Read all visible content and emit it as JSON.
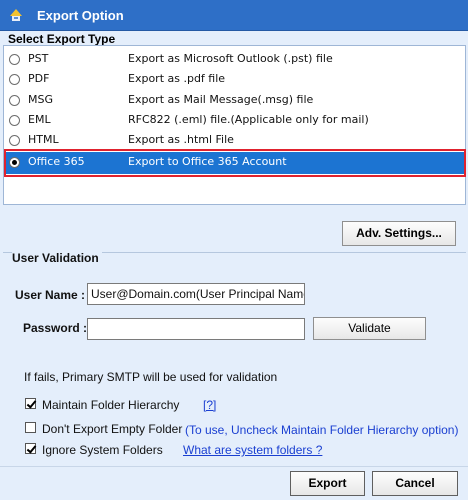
{
  "window": {
    "title": "Export Option"
  },
  "export_type": {
    "section_title": "Select Export Type",
    "options": [
      {
        "name": "PST",
        "description": "Export as Microsoft Outlook (.pst) file",
        "selected": false
      },
      {
        "name": "PDF",
        "description": "Export as .pdf file",
        "selected": false
      },
      {
        "name": "MSG",
        "description": "Export as Mail Message(.msg) file",
        "selected": false
      },
      {
        "name": "EML",
        "description": "RFC822 (.eml) file.(Applicable only for mail)",
        "selected": false
      },
      {
        "name": "HTML",
        "description": "Export as .html File",
        "selected": false
      },
      {
        "name": "Office 365",
        "description": "Export to Office 365 Account",
        "selected": true
      }
    ],
    "selected_color": "#1c74d2",
    "highlight_color": "#e0222e"
  },
  "adv_settings": {
    "label": "Adv. Settings..."
  },
  "user_validation": {
    "title": "User Validation",
    "username_label": "User Name :",
    "username_value": "User@Domain.com(User Principal Name)",
    "password_label": "Password :",
    "password_value": "",
    "validate_label": "Validate",
    "note": "If fails, Primary SMTP will be used for validation"
  },
  "options": {
    "maintain_hierarchy": {
      "label": "Maintain Folder Hierarchy",
      "checked": true,
      "help_link": "[?]"
    },
    "dont_export_empty": {
      "label": "Don't Export Empty Folder",
      "checked": false,
      "hint": "(To use, Uncheck Maintain Folder Hierarchy option)"
    },
    "ignore_system": {
      "label": "Ignore System Folders",
      "checked": true,
      "link": "What are system folders ?"
    }
  },
  "footer": {
    "export_label": "Export",
    "cancel_label": "Cancel"
  },
  "colors": {
    "titlebar": "#2e6fc7",
    "background": "#e4eefb",
    "link": "#1a3fd1"
  }
}
